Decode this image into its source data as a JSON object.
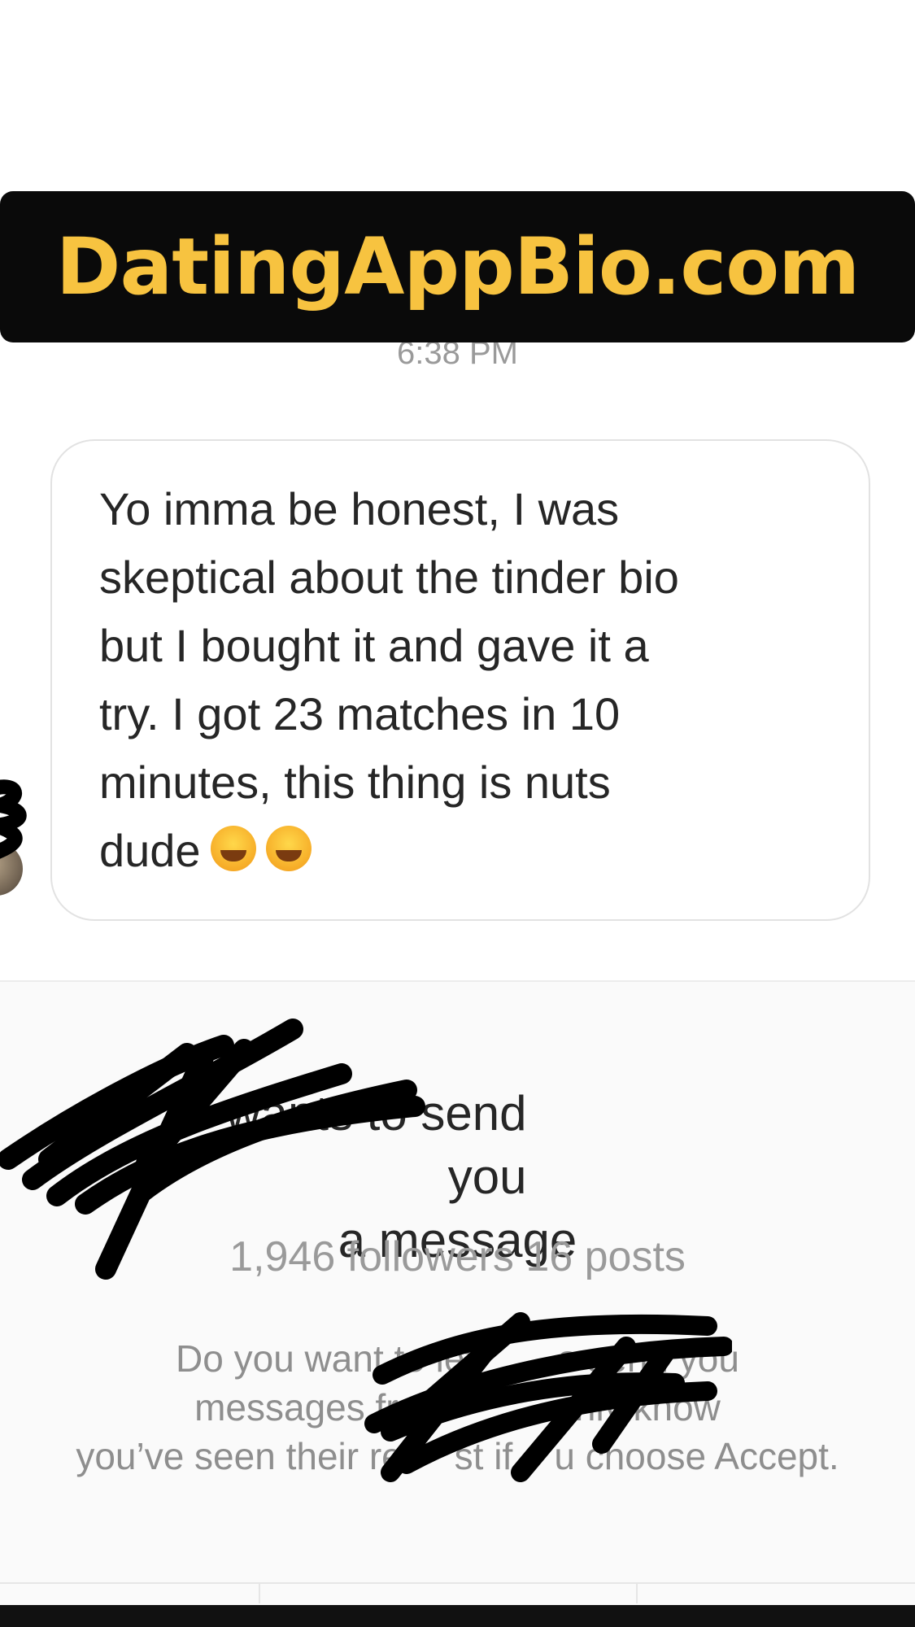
{
  "banner": {
    "text": "DatingAppBio.com",
    "color": "#f7c340",
    "background": "#0a0a0a"
  },
  "timestamp": "6:38 PM",
  "message": {
    "text": "Yo imma be honest, I was\nskeptical about the tinder bio\nbut I bought it and gave it a\ntry. I got 23 matches in 10\nminutes, this thing is nuts\ndude",
    "emojis": [
      "face-with-tears-of-joy",
      "face-with-tears-of-joy"
    ]
  },
  "request": {
    "title_line1_visible": "s wants to send you",
    "title_line2": "a message",
    "stats": "1,946 followers 16 posts",
    "description": "Do you want to let        s send you\nmessages from          only know\nyou’ve seen their re     st if    u choose Accept."
  },
  "redactions": [
    "scribble-redaction-username",
    "scribble-redaction-username-2",
    "scribble-redaction-avatar"
  ]
}
